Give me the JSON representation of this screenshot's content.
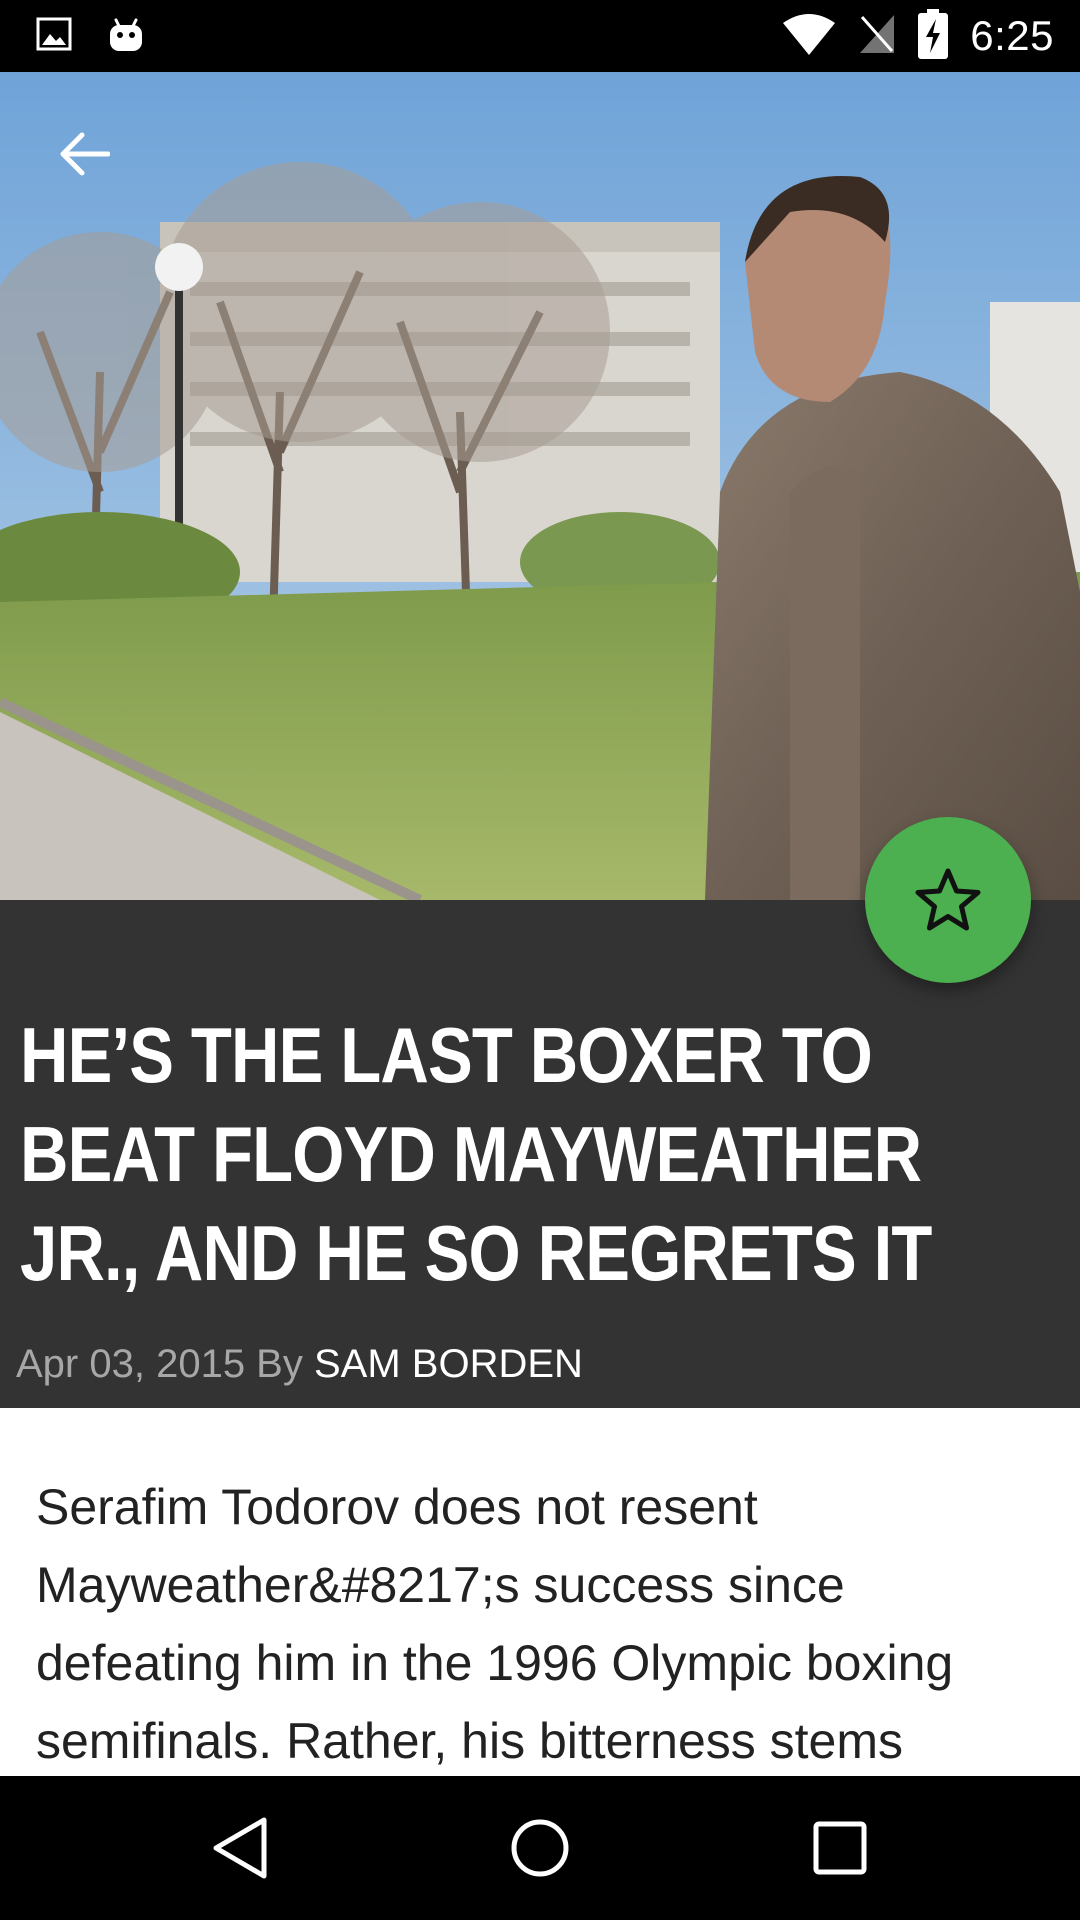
{
  "status_bar": {
    "time": "6:25",
    "icons_left": [
      "image-icon",
      "android-icon"
    ],
    "icons_right": [
      "wifi-icon",
      "no-signal-icon",
      "battery-charging-icon"
    ]
  },
  "hero": {
    "alt": "Photo of a man in a brown puffer jacket in a park"
  },
  "article": {
    "title": "HE’S THE LAST BOXER TO BEAT FLOYD MAYWEATHER JR., AND HE SO REGRETS IT",
    "date_prefix": "Apr 03, 2015 By",
    "author": "SAM BORDEN",
    "body": "Serafim Todorov does not resent Mayweather&#8217;s success since defeating him in the 1996 Olympic boxing semifinals. Rather, his bitterness stems"
  },
  "fab": {
    "icon": "star-outline-icon",
    "color": "#4caf50"
  },
  "colors": {
    "title_band": "#333333",
    "accent": "#4caf50"
  },
  "nav": {
    "icons": [
      "back-triangle-icon",
      "home-circle-icon",
      "recents-square-icon"
    ]
  }
}
